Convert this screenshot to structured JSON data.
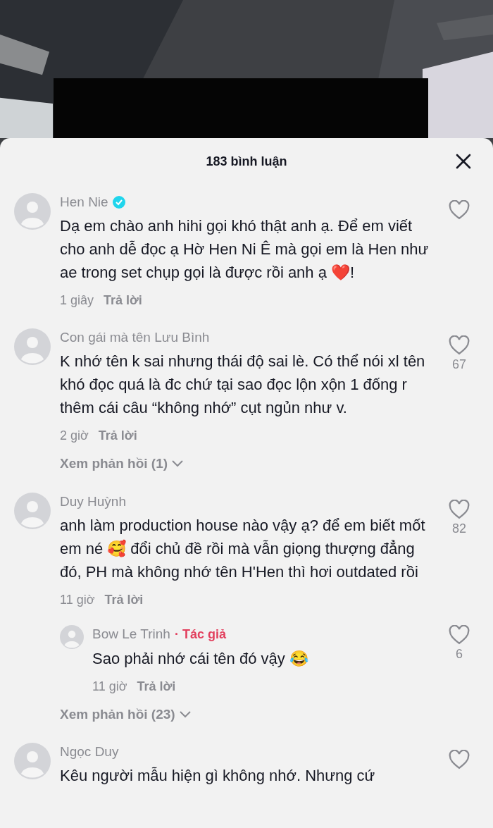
{
  "sheet": {
    "title": "183 bình luận"
  },
  "comments": [
    {
      "author": "Hen Nie",
      "verified": true,
      "text": "Dạ em chào anh hihi gọi khó thật anh ạ. Để em viết cho anh dễ đọc ạ Hờ Hen Ni Ê mà gọi em là Hen như ae trong set chụp gọi là được rồi anh ạ ❤️!",
      "time": "1 giây",
      "reply_label": "Trả lời"
    },
    {
      "author": "Con gái mà tên Lưu Bình",
      "verified": false,
      "text": "K nhớ tên k sai nhưng thái độ sai lè. Có thể nói xl tên khó đọc quá là đc chứ tại sao đọc lộn xộn 1 đống r thêm cái câu “không nhớ” cụt ngủn như v.",
      "time": "2 giờ",
      "reply_label": "Trả lời",
      "likes": "67",
      "view_replies": "Xem phản hồi (1)"
    },
    {
      "author": "Duy Huỳnh",
      "verified": false,
      "text": "anh làm production house nào vậy ạ? để em biết mốt em né 🥰 đổi chủ đề rồi mà vẫn giọng thượng đẳng đó, PH mà không nhớ tên H'Hen thì hơi outdated rồi",
      "time": "11 giờ",
      "reply_label": "Trả lời",
      "likes": "82",
      "view_replies": "Xem phản hồi (23)",
      "replies": [
        {
          "author": "Bow Le Trinh",
          "badge": "· Tác giả",
          "text": "Sao phải nhớ cái tên đó vậy 😂",
          "time": "11 giờ",
          "reply_label": "Trả lời",
          "likes": "6"
        }
      ]
    },
    {
      "author": "Ngọc Duy",
      "verified": false,
      "text": "Kêu người mẫu hiện gì không nhớ. Nhưng cứ"
    }
  ]
}
